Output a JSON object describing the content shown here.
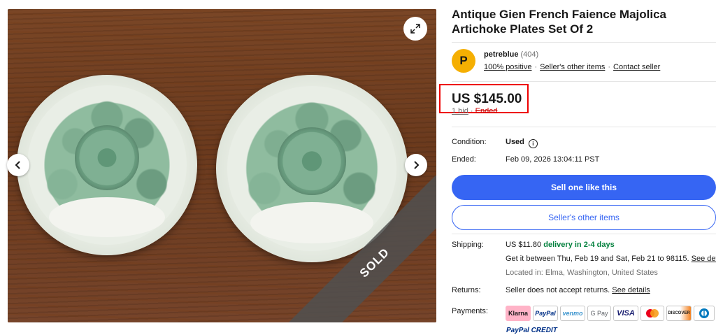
{
  "listing": {
    "title": "Antique Gien French Faience Majolica Artichoke Plates Set Of 2",
    "sold_label": "SOLD"
  },
  "seller": {
    "initial": "P",
    "name": "petreblue",
    "count": "(404)",
    "positive": "100% positive",
    "other_items": "Seller's other items",
    "contact": "Contact seller"
  },
  "price": {
    "amount": "US $145.00",
    "bids": "1 bid",
    "status": "Ended"
  },
  "details": {
    "condition_label": "Condition:",
    "condition_value": "Used",
    "ended_label": "Ended:",
    "ended_value": "Feb 09, 2026 13:04:11 PST"
  },
  "buttons": {
    "sell_one": "Sell one like this",
    "sellers_other": "Seller's other items"
  },
  "shipping": {
    "label": "Shipping:",
    "cost": "US $11.80",
    "delivery": "delivery in 2-4 days",
    "window": "Get it between Thu, Feb 19 and Sat, Feb 21 to 98115.",
    "see_details": "See details",
    "location": "Located in: Elma, Washington, United States"
  },
  "returns": {
    "label": "Returns:",
    "value": "Seller does not accept returns.",
    "see_details": "See details"
  },
  "payments": {
    "label": "Payments:",
    "methods": [
      "Klarna",
      "PayPal",
      "venmo",
      "G Pay",
      "VISA",
      "Mastercard",
      "DISCOVER",
      "Diners"
    ],
    "paypal_credit": "PayPal CREDIT"
  },
  "colors": {
    "accent": "#3665f3",
    "green": "#05823f",
    "highlight": "#ee0000",
    "avatar": "#f5af02"
  }
}
